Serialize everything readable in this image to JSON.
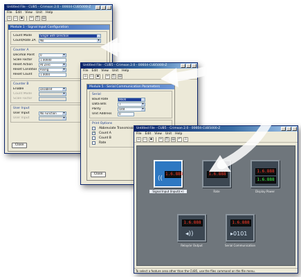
{
  "menu": [
    "File",
    "Edit",
    "View",
    "Unit",
    "Help"
  ],
  "window1": {
    "title": "Untitled File - CUB5 - Crimson 2.0 - 00604-CUB5000-Z",
    "dialog_title": "Module 1 - Signal Input Configuration",
    "top_rows": [
      {
        "label": "Count Mode",
        "value": "Single with Direction",
        "highlight": true
      },
      {
        "label": "Count/Rate 2A Reset on",
        "value": "No",
        "highlight": false
      }
    ],
    "counter_a": {
      "label": "Counter A",
      "rows": [
        {
          "label": "Decimal Point",
          "value": "0"
        },
        {
          "label": "Scale Factor",
          "value": "1.00000"
        },
        {
          "label": "Reset Action",
          "value": "At Zero"
        },
        {
          "label": "Reset Condition",
          "value": "Rising"
        },
        {
          "label": "Reset Count",
          "value": "1.0000"
        }
      ]
    },
    "counter_b": {
      "label": "Counter B",
      "rows": [
        {
          "label": "Enable",
          "value": "Disabled"
        },
        {
          "label": "Count Mode",
          "value": ""
        },
        {
          "label": "Scale Factor",
          "value": ""
        }
      ]
    },
    "user_input": {
      "label": "User Input",
      "rows": [
        {
          "label": "User Input",
          "value": "No Function"
        },
        {
          "label": "User Input",
          "value": ""
        }
      ]
    },
    "close_label": "Close"
  },
  "window2": {
    "title": "Untitled File - CUB5 - Crimson 2.0 - 00604-CUB5000-Z",
    "dialog_title": "Module 5 - Serial Communication Parameters",
    "serial_label": "Serial",
    "serial_rows": [
      {
        "label": "Baud Rate",
        "value": "9600",
        "highlight": true
      },
      {
        "label": "Data Bits",
        "value": "7"
      },
      {
        "label": "Parity",
        "value": "Odd"
      },
      {
        "label": "Unit Address",
        "value": "0"
      }
    ],
    "print_label": "Print Options",
    "print_rows": [
      {
        "label": "Abbreviate Transmissions",
        "checked": false
      },
      {
        "label": "Count A",
        "checked": true
      },
      {
        "label": "Count B",
        "checked": false
      },
      {
        "label": "Rate",
        "checked": false
      }
    ],
    "close_label": "Close"
  },
  "window3": {
    "title": "Untitled File - CUB5 - Crimson 2.0 - 00604-CUB5000-Z",
    "tiles": [
      {
        "caption": "Signal Input (Input)(+)",
        "lcd": "1.6.888",
        "lcd2": "",
        "glyph": "((",
        "active": true
      },
      {
        "caption": "Rate",
        "lcd": "1.6.888",
        "lcd2": "",
        "glyph": "",
        "active": false
      },
      {
        "caption": "Display Power",
        "lcd": "1.6.888",
        "lcd2": "1.6.888",
        "glyph": "",
        "active": false
      },
      {
        "caption": "Relay/or Output",
        "lcd": "1.6.888",
        "lcd2": "",
        "glyph": "◂))",
        "active": false
      },
      {
        "caption": "Serial Communication",
        "lcd": "1.6.888",
        "lcd2": "",
        "glyph": "▸0101",
        "active": false
      }
    ],
    "status": "To select a feature area other than the CUB5, use the files command on the file menu."
  },
  "colors": {
    "accent": "#0a246a",
    "tile_bg": "#3c4752",
    "lcd_red": "#ff3a2a",
    "lcd_green": "#3cff4a"
  }
}
